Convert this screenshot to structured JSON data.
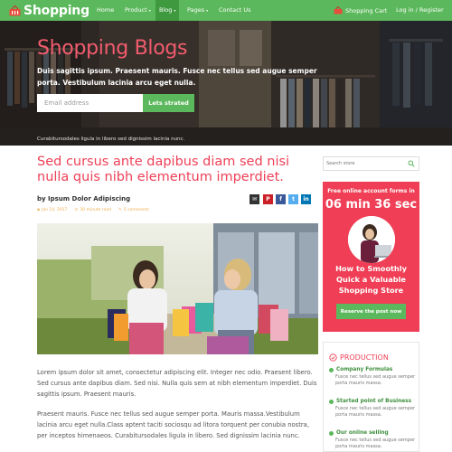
{
  "nav": {
    "brand": "Shopping",
    "items": [
      {
        "label": "Home",
        "caret": ""
      },
      {
        "label": "Product",
        "caret": "▾"
      },
      {
        "label": "Blog",
        "caret": "▾"
      },
      {
        "label": "Pages",
        "caret": "▾"
      },
      {
        "label": "Contact Us",
        "caret": ""
      }
    ],
    "cart_label": "Shopping Cart",
    "login_label": "Log in / Register",
    "color": "#5cb85c"
  },
  "hero": {
    "title": "Shopping Blogs",
    "subtitle": "Duis sagittis ipsum. Praesent mauris. Fusce nec tellus sed augue semper porta. Vestibulum lacinia arcu eget nulla.",
    "email_placeholder": "Email address",
    "subscribe_label": "Lets strated",
    "note": "Curabitursodales ligula in libero sed dignissim lacinia nunc."
  },
  "post": {
    "title": "Sed cursus ante dapibus diam sed nisi nulla quis nibh elementum imperdiet.",
    "byline": "by Ipsum Dolor Adipiscing",
    "date": "Jan 14, 2017",
    "read_time": "30 minute read",
    "comments": "5 comments",
    "paragraph1": "Lorem ipsum dolor sit amet, consectetur adipiscing elit. Integer nec odio. Praesent libero. Sed cursus ante dapibus diam. Sed nisi. Nulla quis sem at nibh elementum imperdiet. Duis sagittis ipsum. Praesent mauris.",
    "paragraph2": "Praesent mauris. Fusce nec tellus sed augue semper porta. Mauris massa.Vestibulum lacinia arcu eget nulla.Class aptent taciti sociosqu ad litora torquent per conubia nostra, per inceptos himenaeos. Curabitursodales ligula in libero. Sed dignissim lacinia nunc."
  },
  "share": [
    {
      "icon": "email-share-icon",
      "glyph": "✉",
      "color": "#333333"
    },
    {
      "icon": "pinterest-share-icon",
      "glyph": "P",
      "color": "#cb2027"
    },
    {
      "icon": "facebook-share-icon",
      "glyph": "f",
      "color": "#3b5998"
    },
    {
      "icon": "twitter-share-icon",
      "glyph": "t",
      "color": "#55acee"
    },
    {
      "icon": "linkedin-share-icon",
      "glyph": "in",
      "color": "#0077b5"
    }
  ],
  "sidebar": {
    "search_placeholder": "Search store",
    "promo": {
      "top": "Free online account forms in",
      "timer": "06 min 36 sec",
      "heading": "How to Smoothly Quick a Valuable Shopping Store",
      "button": "Reserve the post now",
      "color": "#ef3e55"
    },
    "category": {
      "title": "PRODUCTION",
      "items": [
        {
          "title": "Company Formulas",
          "desc": "Fusce nec tellus sed augue semper porta mauris massa."
        },
        {
          "title": "Started point of Business",
          "desc": "Fusce nec tellus sed augue semper porta mauris massa."
        },
        {
          "title": "Our online selling",
          "desc": "Fusce nec tellus sed augue semper porta mauris massa."
        }
      ]
    }
  }
}
